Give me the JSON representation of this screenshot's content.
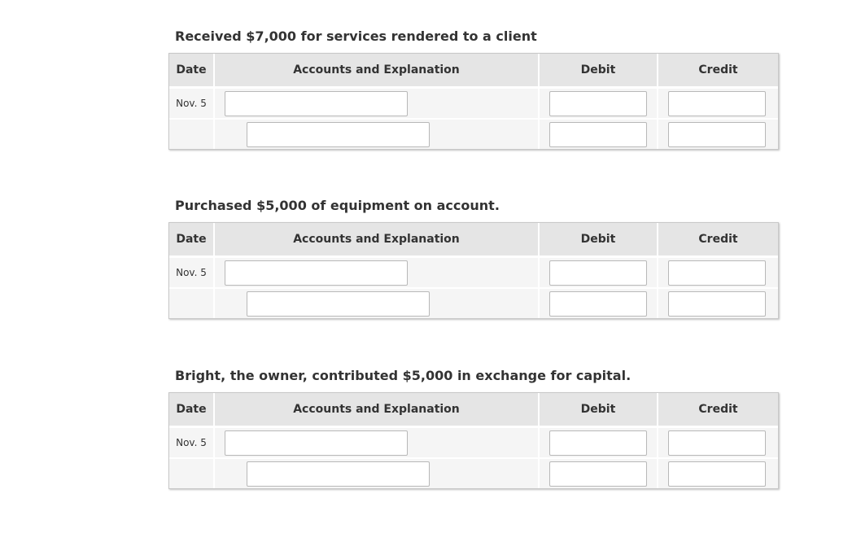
{
  "columns": {
    "date": "Date",
    "accounts": "Accounts and Explanation",
    "debit": "Debit",
    "credit": "Credit"
  },
  "entries": [
    {
      "title": "Received $7,000 for services rendered to a client",
      "date": "Nov. 5",
      "rows": [
        {
          "account": "",
          "debit": "",
          "credit": ""
        },
        {
          "account": "",
          "debit": "",
          "credit": ""
        }
      ]
    },
    {
      "title": "Purchased $5,000 of equipment on account.",
      "date": "Nov. 5",
      "rows": [
        {
          "account": "",
          "debit": "",
          "credit": ""
        },
        {
          "account": "",
          "debit": "",
          "credit": ""
        }
      ]
    },
    {
      "title": "Bright, the owner, contributed $5,000 in exchange for capital.",
      "date": "Nov. 5",
      "rows": [
        {
          "account": "",
          "debit": "",
          "credit": ""
        },
        {
          "account": "",
          "debit": "",
          "credit": ""
        }
      ]
    }
  ]
}
